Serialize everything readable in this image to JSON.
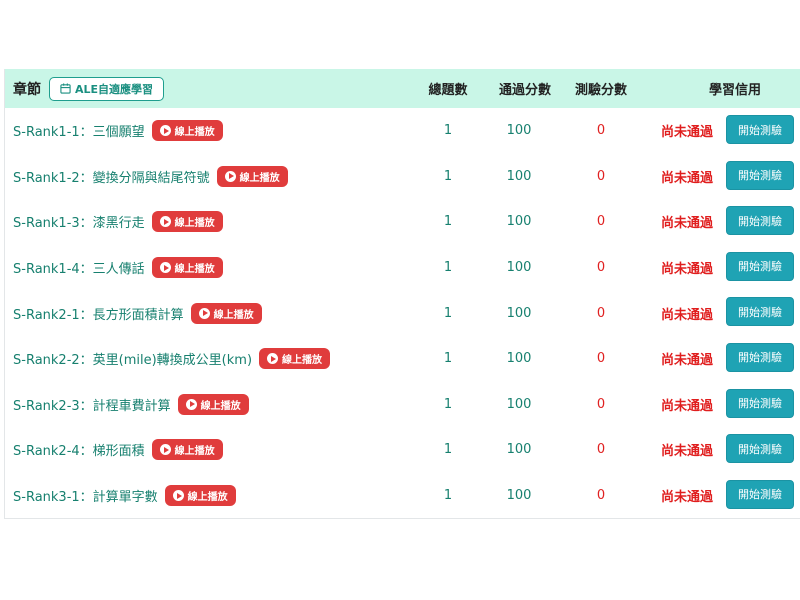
{
  "header": {
    "chapter": "章節",
    "ale_button": "ALE自適應學習",
    "total": "總題數",
    "passed": "通過分數",
    "test": "測驗分數",
    "credit": "學習信用"
  },
  "play_label": "線上播放",
  "start_label": "開始測驗",
  "rows": [
    {
      "title": "S-Rank1-1：三個願望",
      "total": "1",
      "pass": "100",
      "test": "0",
      "status": "尚未通過"
    },
    {
      "title": "S-Rank1-2：變換分隔與結尾符號",
      "total": "1",
      "pass": "100",
      "test": "0",
      "status": "尚未通過"
    },
    {
      "title": "S-Rank1-3：漆黑行走",
      "total": "1",
      "pass": "100",
      "test": "0",
      "status": "尚未通過"
    },
    {
      "title": "S-Rank1-4：三人傳話",
      "total": "1",
      "pass": "100",
      "test": "0",
      "status": "尚未通過"
    },
    {
      "title": "S-Rank2-1：長方形面積計算",
      "total": "1",
      "pass": "100",
      "test": "0",
      "status": "尚未通過"
    },
    {
      "title": "S-Rank2-2：英里(mile)轉換成公里(km)",
      "total": "1",
      "pass": "100",
      "test": "0",
      "status": "尚未通過"
    },
    {
      "title": "S-Rank2-3：計程車費計算",
      "total": "1",
      "pass": "100",
      "test": "0",
      "status": "尚未通過"
    },
    {
      "title": "S-Rank2-4：梯形面積",
      "total": "1",
      "pass": "100",
      "test": "0",
      "status": "尚未通過"
    },
    {
      "title": "S-Rank3-1：計算單字數",
      "total": "1",
      "pass": "100",
      "test": "0",
      "status": "尚未通過"
    }
  ],
  "icons": {
    "ale": "calendar-icon",
    "play": "play-circle-icon"
  },
  "colors": {
    "header_bg": "#c9f6e7",
    "accent": "#17806f",
    "badge": "#e03c3c",
    "status": "#e01e1e",
    "button": "#1fa3b4"
  }
}
